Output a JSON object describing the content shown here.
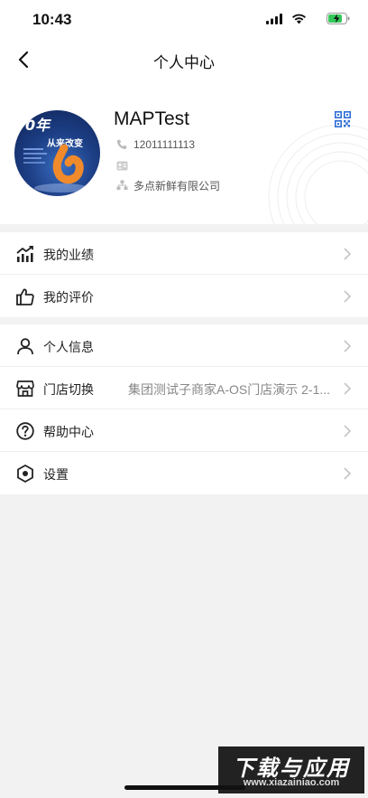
{
  "status_bar": {
    "time": "10:43"
  },
  "nav": {
    "title": "个人中心"
  },
  "profile": {
    "name": "MAPTest",
    "phone": "12011111113",
    "card": "",
    "company": "多点新鲜有限公司",
    "avatar_text": "从来改变"
  },
  "menu_group_1": [
    {
      "label": "我的业绩",
      "icon": "chart-icon"
    },
    {
      "label": "我的评价",
      "icon": "thumbs-up-icon"
    }
  ],
  "menu_group_2": [
    {
      "label": "个人信息",
      "icon": "person-icon",
      "value": ""
    },
    {
      "label": "门店切换",
      "icon": "store-icon",
      "value": "集团测试子商家A-OS门店演示 2-1..."
    },
    {
      "label": "帮助中心",
      "icon": "help-icon",
      "value": ""
    },
    {
      "label": "设置",
      "icon": "settings-icon",
      "value": ""
    }
  ],
  "watermark": {
    "main": "下载与应用",
    "url": "www.xiazainiao.com"
  },
  "colors": {
    "accent_blue": "#2f6fd6",
    "background": "#f2f2f2"
  }
}
